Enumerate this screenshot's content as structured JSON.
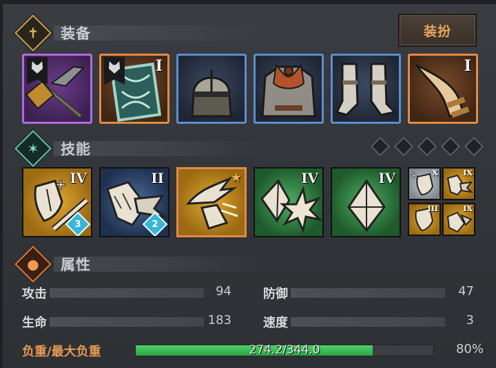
{
  "sections": {
    "equipment_title": "装备",
    "skills_title": "技能",
    "attributes_title": "属性"
  },
  "dress_button_label": "装扮",
  "equipment_slots": [
    {
      "name": "warhammer",
      "rarity": "purple",
      "tier": "",
      "has_banner": true
    },
    {
      "name": "shield",
      "rarity": "orange",
      "tier": "I",
      "has_banner": true
    },
    {
      "name": "helmet",
      "rarity": "blue",
      "tier": ""
    },
    {
      "name": "chainmail-armor",
      "rarity": "blue",
      "tier": ""
    },
    {
      "name": "boots",
      "rarity": "blue",
      "tier": ""
    },
    {
      "name": "horn-accessory",
      "rarity": "orange",
      "tier": "I"
    }
  ],
  "skill_slots_pips": 5,
  "skills": [
    {
      "name": "shield-and-sword",
      "color": "gold",
      "tier": "IV",
      "badge": "3"
    },
    {
      "name": "shield-bash",
      "color": "navy",
      "tier": "II",
      "badge": "2"
    },
    {
      "name": "bird-strike",
      "color": "gold",
      "tier": "",
      "starred": true
    },
    {
      "name": "crystal-burst",
      "color": "green",
      "tier": "IV"
    },
    {
      "name": "crystal-shield",
      "color": "green",
      "tier": "IV"
    }
  ],
  "mini_skills": [
    {
      "name": "shield-heal",
      "color": "grey",
      "tier": "X"
    },
    {
      "name": "shield-bash-mini",
      "color": "gold",
      "tier": "IX"
    },
    {
      "name": "shield-guard",
      "color": "gold",
      "tier": "III"
    },
    {
      "name": "shield-break",
      "color": "gold",
      "tier": "IX"
    }
  ],
  "stats": {
    "attack_label": "攻击",
    "attack_value": "94",
    "defense_label": "防御",
    "defense_value": "47",
    "hp_label": "生命",
    "hp_value": "183",
    "speed_label": "速度",
    "speed_value": "3"
  },
  "load": {
    "label": "负重/最大负重",
    "text": "274.2/344.0",
    "percent_text": "80%",
    "fraction": 0.797
  },
  "colors": {
    "purple": "#b26be0",
    "orange": "#e48a43",
    "blue": "#5c8fd0",
    "load_green": "#3cc257",
    "accent": "#e39a52"
  }
}
